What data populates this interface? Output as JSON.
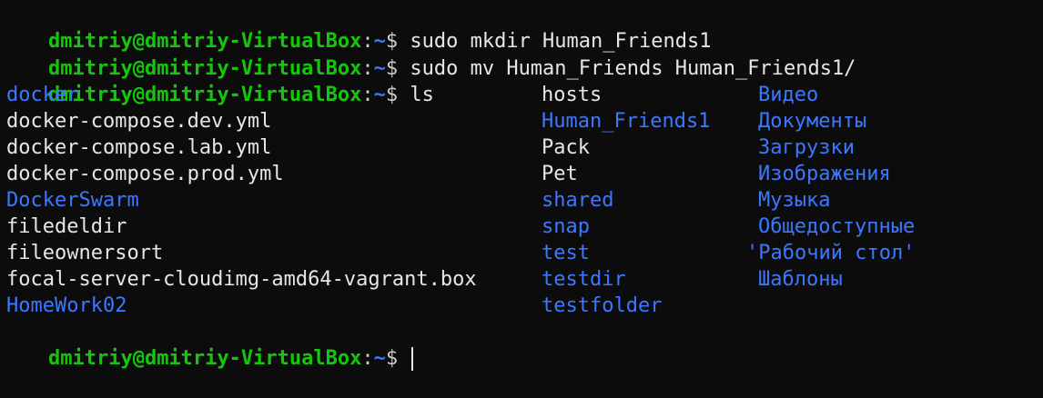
{
  "terminal": {
    "colors": {
      "background": "#0c0c0c",
      "user": "#16c60c",
      "path": "#3b78ff",
      "directory": "#3b78ff",
      "text": "#e6e6e6"
    },
    "prompt_user": "dmitriy@dmitriy-VirtualBox",
    "prompt_colon": ":",
    "prompt_path": "~",
    "prompt_symbol": "$ ",
    "commands": [
      "sudo mkdir Human_Friends1",
      "sudo mv Human_Friends Human_Friends1/",
      "ls"
    ],
    "ls_output": {
      "column1": [
        {
          "name": "docker",
          "type": "dir"
        },
        {
          "name": "docker-compose.dev.yml",
          "type": "file"
        },
        {
          "name": "docker-compose.lab.yml",
          "type": "file"
        },
        {
          "name": "docker-compose.prod.yml",
          "type": "file"
        },
        {
          "name": "DockerSwarm",
          "type": "dir"
        },
        {
          "name": "filedeldir",
          "type": "file"
        },
        {
          "name": "fileownersort",
          "type": "file"
        },
        {
          "name": "focal-server-cloudimg-amd64-vagrant.box",
          "type": "file"
        },
        {
          "name": "HomeWork02",
          "type": "dir"
        }
      ],
      "column2": [
        {
          "name": "hosts",
          "type": "file"
        },
        {
          "name": "Human_Friends1",
          "type": "dir"
        },
        {
          "name": "Pack",
          "type": "file"
        },
        {
          "name": "Pet",
          "type": "file"
        },
        {
          "name": "shared",
          "type": "dir"
        },
        {
          "name": "snap",
          "type": "dir"
        },
        {
          "name": "test",
          "type": "dir"
        },
        {
          "name": "testdir",
          "type": "dir"
        },
        {
          "name": "testfolder",
          "type": "dir"
        }
      ],
      "column3": [
        {
          "name": "Видео",
          "type": "dir"
        },
        {
          "name": "Документы",
          "type": "dir"
        },
        {
          "name": "Загрузки",
          "type": "dir"
        },
        {
          "name": "Изображения",
          "type": "dir"
        },
        {
          "name": "Музыка",
          "type": "dir"
        },
        {
          "name": "Общедоступные",
          "type": "dir"
        },
        {
          "name": "'Рабочий стол'",
          "type": "dir"
        },
        {
          "name": "Шаблоны",
          "type": "dir"
        }
      ]
    }
  }
}
